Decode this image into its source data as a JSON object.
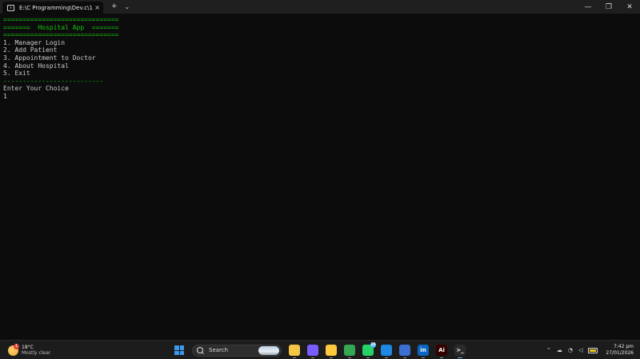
{
  "window": {
    "tab_title": "E:\\C Programming\\Dev.c\\1st S",
    "tab_close": "×",
    "new_tab": "+",
    "dropdown": "⌄",
    "controls": {
      "minimize": "—",
      "maximize": "❐",
      "close": "✕"
    }
  },
  "terminal": {
    "lines": [
      {
        "text": "==============================",
        "color": "green"
      },
      {
        "text": "=======  Hospital App  =======",
        "color": "green"
      },
      {
        "text": "==============================",
        "color": "green"
      },
      {
        "text": "1. Manager Login",
        "color": "white"
      },
      {
        "text": "2. Add Patient",
        "color": "white"
      },
      {
        "text": "3. Appointment to Doctor",
        "color": "white"
      },
      {
        "text": "4. About Hospital",
        "color": "white"
      },
      {
        "text": "5. Exit",
        "color": "white"
      },
      {
        "text": "--------------------------",
        "color": "green"
      },
      {
        "text": "Enter Your Choice",
        "color": "white"
      },
      {
        "text": "1",
        "color": "white"
      }
    ]
  },
  "taskbar": {
    "weather": {
      "temp": "18°C",
      "condition": "Mostly clear",
      "badge": "1"
    },
    "search_label": "Search",
    "apps": [
      {
        "name": "file-explorer-icon",
        "glyph": "",
        "color": "#f3c445"
      },
      {
        "name": "copilot-icon",
        "glyph": "",
        "color": "#7b5cff"
      },
      {
        "name": "folder-icon",
        "glyph": "",
        "color": "#ffc83d"
      },
      {
        "name": "chrome-icon",
        "glyph": "",
        "color": "#34a853"
      },
      {
        "name": "whatsapp-icon",
        "glyph": "",
        "color": "#25d366",
        "badge": "10"
      },
      {
        "name": "vscode-icon",
        "glyph": "",
        "color": "#1e88e5"
      },
      {
        "name": "calendar-app-icon",
        "glyph": "",
        "color": "#3b6fd1"
      },
      {
        "name": "linkedin-icon",
        "glyph": "in",
        "color": "#0a66c2"
      },
      {
        "name": "illustrator-icon",
        "glyph": "Ai",
        "color": "#330000"
      },
      {
        "name": "terminal-icon",
        "glyph": ">_",
        "color": "#2b2b2b"
      }
    ],
    "tray": {
      "chevron": "⌃",
      "cloud": "☁",
      "wifi": "◔",
      "volume": "◁"
    },
    "clock": {
      "time": "7:42 pm",
      "date": "27/01/2026"
    }
  },
  "colors": {
    "terminal_bg": "#0c0c0c",
    "terminal_green": "#16c60c",
    "terminal_text": "#cccccc",
    "accent": "#5fb2ff"
  }
}
